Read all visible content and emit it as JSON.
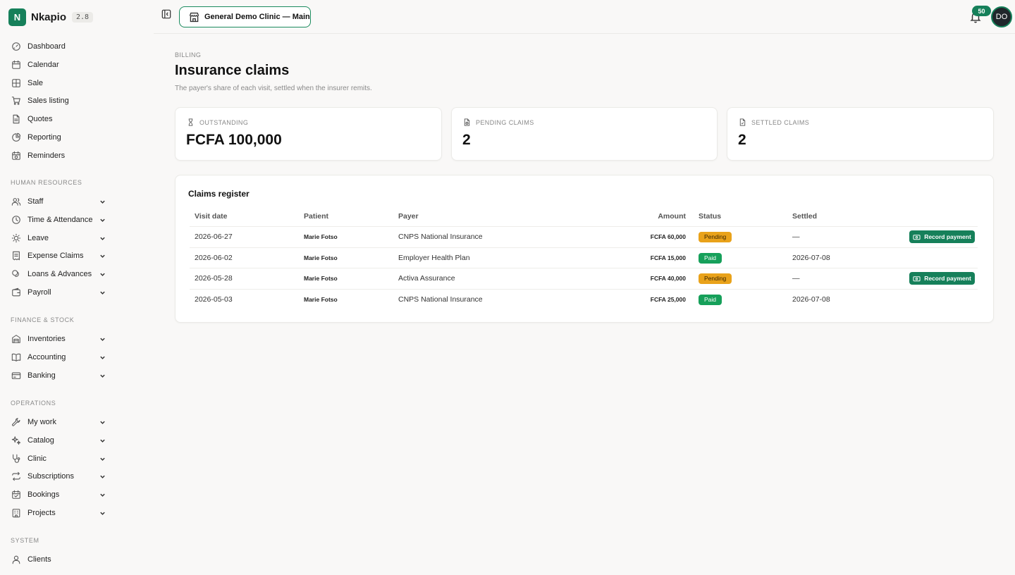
{
  "app": {
    "name": "Nkapio",
    "version": "2.8",
    "logo_letter": "N",
    "accent": "#16805a"
  },
  "topbar": {
    "clinic": "General Demo Clinic — Main",
    "notifications": "50",
    "avatar_initials": "DO"
  },
  "sidebar": {
    "main": [
      {
        "label": "Dashboard",
        "icon": "gauge-icon"
      },
      {
        "label": "Calendar",
        "icon": "calendar-icon"
      },
      {
        "label": "Sale",
        "icon": "grid-icon"
      },
      {
        "label": "Sales listing",
        "icon": "cart-icon"
      },
      {
        "label": "Quotes",
        "icon": "document-icon"
      },
      {
        "label": "Reporting",
        "icon": "pie-chart-icon"
      },
      {
        "label": "Reminders",
        "icon": "calendar-clock-icon"
      }
    ],
    "hr_label": "HUMAN RESOURCES",
    "hr": [
      {
        "label": "Staff",
        "icon": "users-icon"
      },
      {
        "label": "Time & Attendance",
        "icon": "clock-icon"
      },
      {
        "label": "Leave",
        "icon": "sun-icon"
      },
      {
        "label": "Expense Claims",
        "icon": "receipt-icon"
      },
      {
        "label": "Loans & Advances",
        "icon": "coins-icon"
      },
      {
        "label": "Payroll",
        "icon": "wallet-icon"
      }
    ],
    "finance_label": "FINANCE & STOCK",
    "finance": [
      {
        "label": "Inventories",
        "icon": "warehouse-icon"
      },
      {
        "label": "Accounting",
        "icon": "book-icon"
      },
      {
        "label": "Banking",
        "icon": "card-icon"
      }
    ],
    "ops_label": "OPERATIONS",
    "ops": [
      {
        "label": "My work",
        "icon": "wrench-icon"
      },
      {
        "label": "Catalog",
        "icon": "sparkles-icon"
      },
      {
        "label": "Clinic",
        "icon": "stethoscope-icon"
      },
      {
        "label": "Subscriptions",
        "icon": "repeat-icon"
      },
      {
        "label": "Bookings",
        "icon": "calendar-check-icon"
      },
      {
        "label": "Projects",
        "icon": "building-icon"
      }
    ],
    "system_label": "SYSTEM",
    "system": [
      {
        "label": "Clients",
        "icon": "user-icon"
      }
    ]
  },
  "page": {
    "eyebrow": "BILLING",
    "title": "Insurance claims",
    "subtitle": "The payer's share of each visit, settled when the insurer remits."
  },
  "stats": [
    {
      "label": "OUTSTANDING",
      "value": "FCFA 100,000",
      "icon": "hourglass-icon"
    },
    {
      "label": "PENDING CLAIMS",
      "value": "2",
      "icon": "file-clock-icon"
    },
    {
      "label": "SETTLED CLAIMS",
      "value": "2",
      "icon": "file-check-icon"
    }
  ],
  "register": {
    "title": "Claims register",
    "headers": {
      "visit_date": "Visit date",
      "patient": "Patient",
      "payer": "Payer",
      "amount": "Amount",
      "status": "Status",
      "settled": "Settled"
    },
    "action_label": "Record payment",
    "rows": [
      {
        "visit_date": "2026-06-27",
        "patient": "Marie Fotso",
        "payer": "CNPS National Insurance",
        "amount": "FCFA 60,000",
        "status": "Pending",
        "settled": "—",
        "action": true
      },
      {
        "visit_date": "2026-06-02",
        "patient": "Marie Fotso",
        "payer": "Employer Health Plan",
        "amount": "FCFA 15,000",
        "status": "Paid",
        "settled": "2026-07-08",
        "action": false
      },
      {
        "visit_date": "2026-05-28",
        "patient": "Marie Fotso",
        "payer": "Activa Assurance",
        "amount": "FCFA 40,000",
        "status": "Pending",
        "settled": "—",
        "action": true
      },
      {
        "visit_date": "2026-05-03",
        "patient": "Marie Fotso",
        "payer": "CNPS National Insurance",
        "amount": "FCFA 25,000",
        "status": "Paid",
        "settled": "2026-07-08",
        "action": false
      }
    ]
  }
}
